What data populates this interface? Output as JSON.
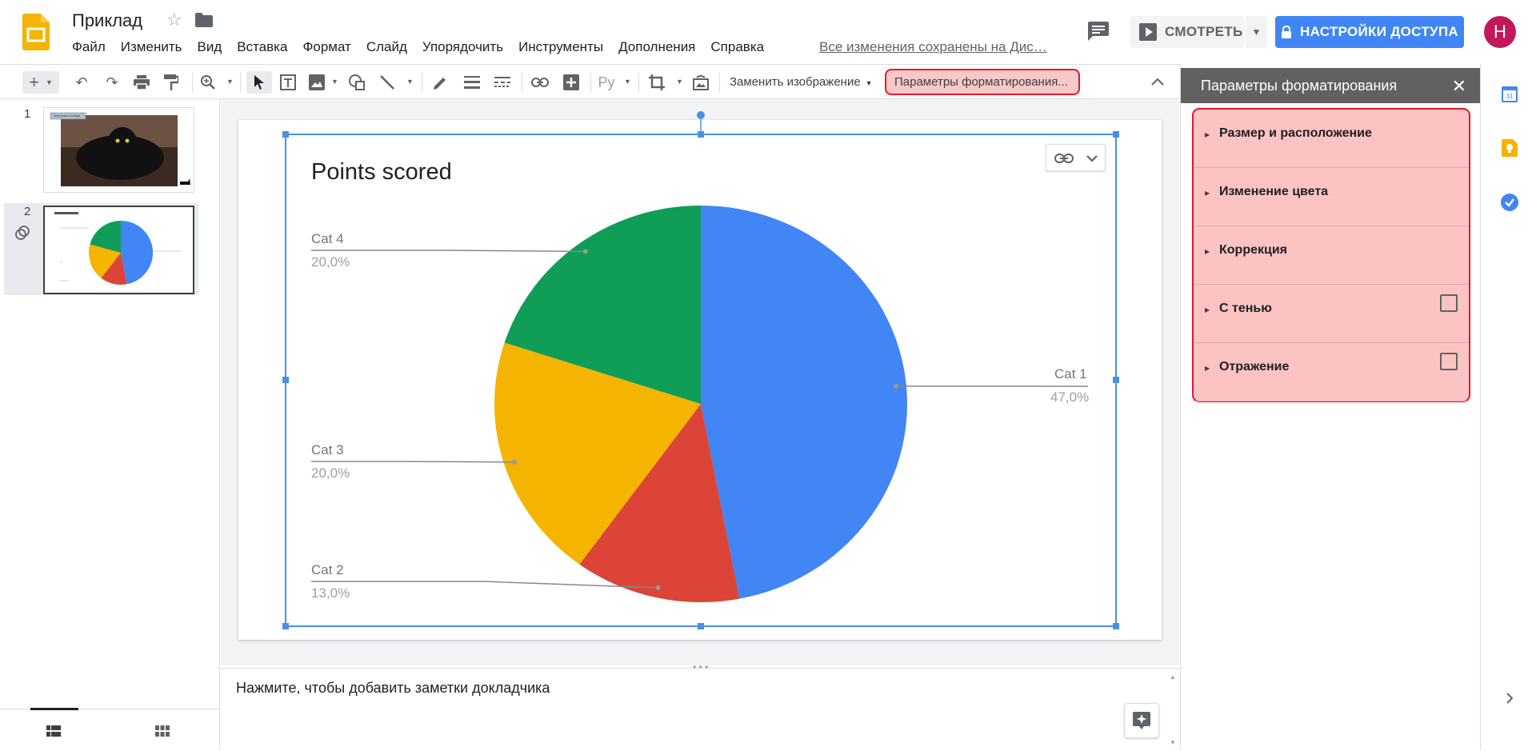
{
  "app": {
    "title": "Приклад",
    "save_status": "Все изменения сохранены на Дис…",
    "avatar_letter": "Н"
  },
  "menu": [
    "Файл",
    "Изменить",
    "Вид",
    "Вставка",
    "Формат",
    "Слайд",
    "Упорядочить",
    "Инструменты",
    "Дополнения",
    "Справка"
  ],
  "header": {
    "present_label": "СМОТРЕТЬ",
    "share_label": "НАСТРОЙКИ ДОСТУПА"
  },
  "toolbar": {
    "replace_image_label": "Заменить изображение",
    "format_options_label": "Параметры форматирования..."
  },
  "filmstrip": {
    "slides": [
      {
        "number": "1"
      },
      {
        "number": "2"
      }
    ],
    "thumb1_caption": "Заголовок слайда"
  },
  "notes": {
    "placeholder": "Нажмите, чтобы добавить заметки докладчика"
  },
  "format_panel": {
    "title": "Параметры форматирования",
    "sections": [
      {
        "label": "Размер и расположение",
        "has_checkbox": false
      },
      {
        "label": "Изменение цвета",
        "has_checkbox": false
      },
      {
        "label": "Коррекция",
        "has_checkbox": false
      },
      {
        "label": "С тенью",
        "has_checkbox": true,
        "checked": false
      },
      {
        "label": "Отражение",
        "has_checkbox": true,
        "checked": false
      }
    ]
  },
  "colors": {
    "accent_blue": "#4285f4",
    "highlight_red": "#e0192b",
    "highlight_fill": "#fcc3c3",
    "avatar": "#c2185b"
  },
  "chart_data": {
    "type": "pie",
    "title": "Points scored",
    "categories": [
      "Cat 1",
      "Cat 2",
      "Cat 3",
      "Cat 4"
    ],
    "values": [
      47.0,
      13.0,
      20.0,
      20.0
    ],
    "value_labels": [
      "47,0%",
      "13,0%",
      "20,0%",
      "20,0%"
    ],
    "colors": [
      "#4285f4",
      "#db4437",
      "#f4b400",
      "#0f9d58"
    ]
  }
}
